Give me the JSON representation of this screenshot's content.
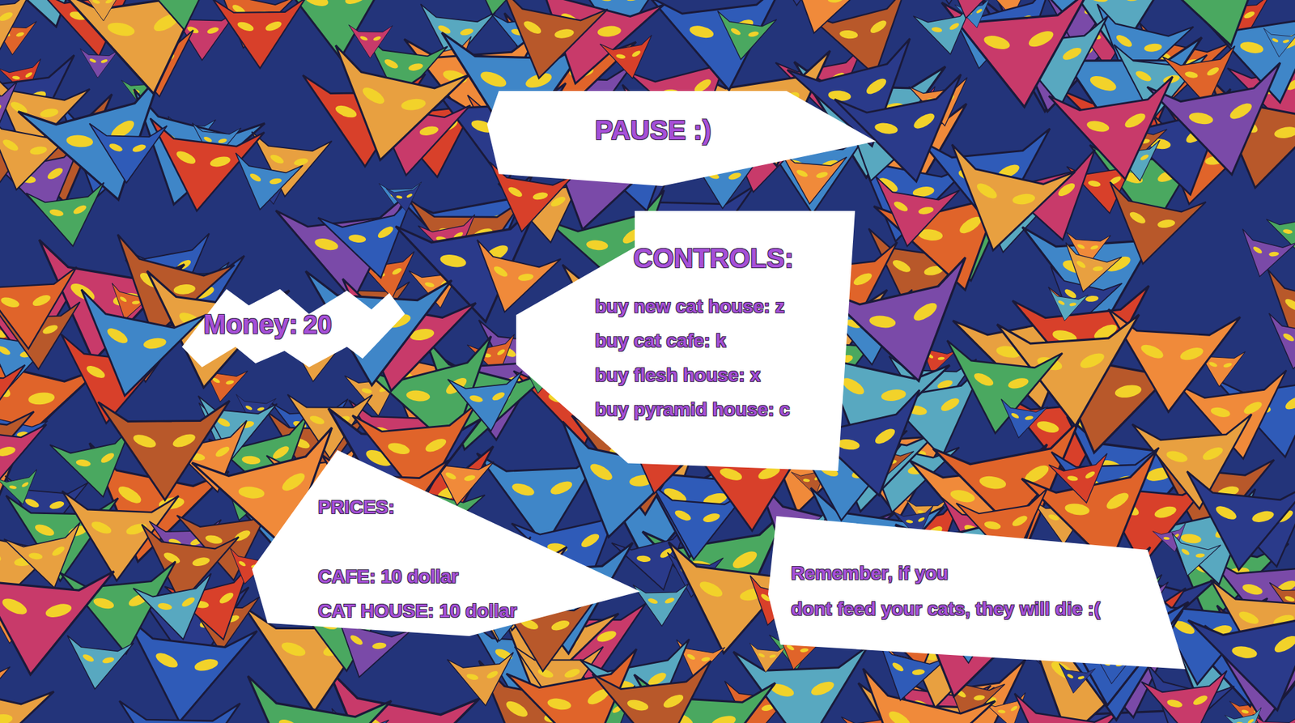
{
  "pause": {
    "title": "PAUSE :)"
  },
  "money": {
    "label": "Money:",
    "value": "20"
  },
  "controls": {
    "title": "CONTROLS:",
    "items": [
      "buy new cat house: z",
      "buy cat cafe: k",
      "buy flesh house: x",
      "buy pyramid house: c"
    ]
  },
  "prices": {
    "title": "PRICES:",
    "items": [
      "CAFE: 10 dollar",
      "CAT HOUSE: 10 dollar"
    ]
  },
  "reminder": {
    "lines": [
      "Remember, if you",
      "dont feed your cats, they will die :("
    ]
  }
}
